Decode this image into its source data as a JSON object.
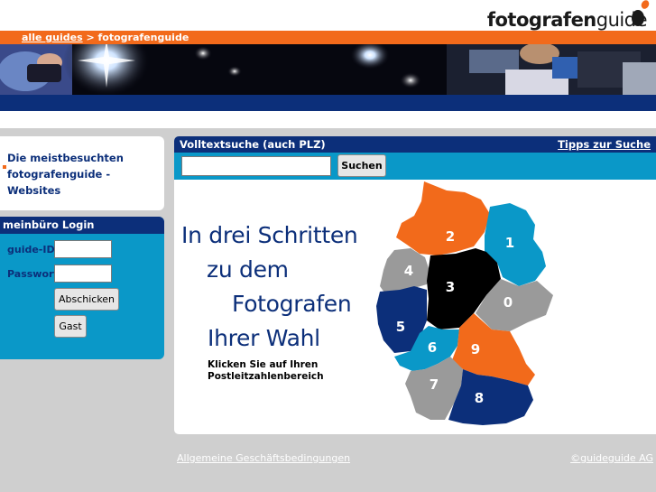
{
  "header": {
    "logo_bold": "fotografen",
    "logo_light": "guide",
    "breadcrumb_link": "alle guides",
    "breadcrumb_sep": " > ",
    "breadcrumb_current": "fotografenguide"
  },
  "sidebar": {
    "popular_line1": "Die meistbesuchten",
    "popular_line2": "fotografenguide -Websites"
  },
  "login": {
    "title": "meinbüro Login",
    "guide_id_label": "guide-ID",
    "guide_id_value": "",
    "password_label": "Passwort",
    "password_value": "",
    "submit_label": "Abschicken",
    "guest_label": "Gast"
  },
  "search": {
    "title": "Volltextsuche (auch PLZ)",
    "tips_link": "Tipps zur Suche",
    "query": "",
    "button_label": "Suchen"
  },
  "intro": {
    "line1": "In drei Schritten",
    "line2": "zu dem",
    "line3": "Fotografen",
    "line4": "Ihrer Wahl",
    "hint1": "Klicken Sie auf Ihren",
    "hint2": "Postleitzahlenbereich"
  },
  "map": {
    "regions": [
      {
        "label": "0",
        "color": "#9a9a9a"
      },
      {
        "label": "1",
        "color": "#0a98c8"
      },
      {
        "label": "2",
        "color": "#f26a1b"
      },
      {
        "label": "3",
        "color": "#000000"
      },
      {
        "label": "4",
        "color": "#9a9a9a"
      },
      {
        "label": "5",
        "color": "#0c2f7a"
      },
      {
        "label": "6",
        "color": "#0a98c8"
      },
      {
        "label": "7",
        "color": "#9a9a9a"
      },
      {
        "label": "8",
        "color": "#0c2f7a"
      },
      {
        "label": "9",
        "color": "#f26a1b"
      }
    ]
  },
  "footer": {
    "terms_link": "Allgemeine Geschäftsbedingungen",
    "copyright_link": "©guideguide AG"
  },
  "colors": {
    "orange": "#f26a1b",
    "navy": "#0c2f7a",
    "cyan": "#0a98c8",
    "gray": "#cfcfcf"
  }
}
